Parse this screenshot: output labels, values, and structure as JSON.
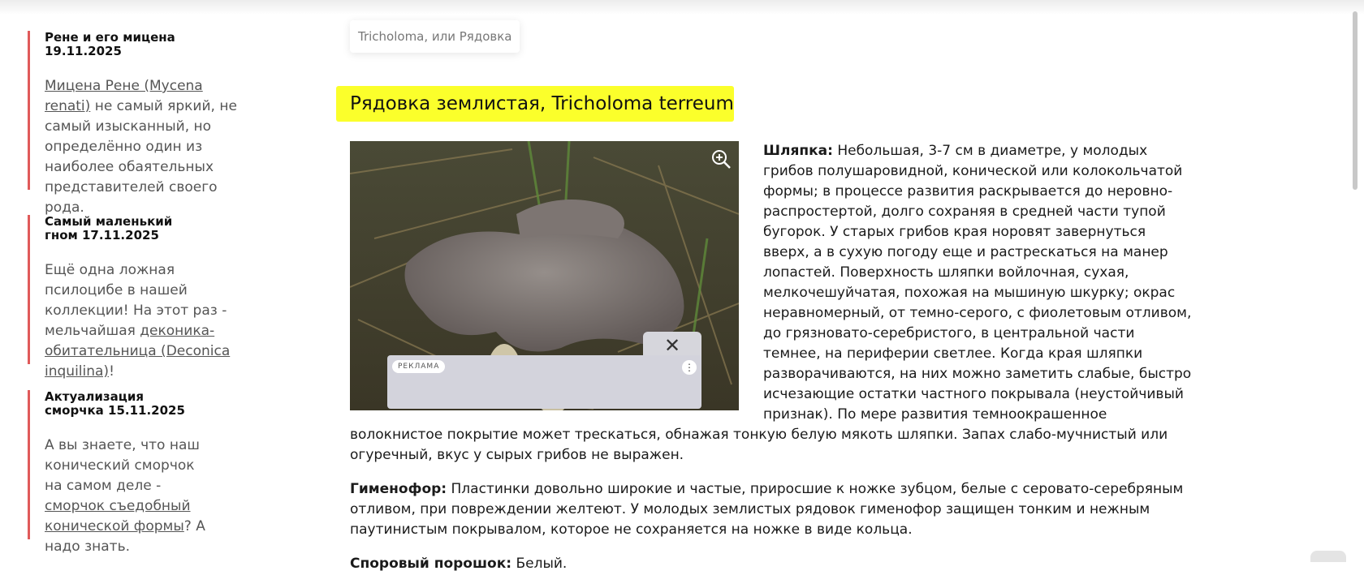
{
  "sidebar": {
    "items": [
      {
        "title": "Рене и его мицена 19.11.2025",
        "text_before": "",
        "link": "Мицена Рене (Mycena renati)",
        "text_after": " не самый яркий, не самый изысканный, но определённо один из наиболее обаятельных представителей своего рода."
      },
      {
        "title": "Самый маленький гном 17.11.2025",
        "text_before": "Ещё одна ложная псилоцибе в нашей коллекции! На этот раз - мельчайшая ",
        "link": "деконика-обитательница (Deconica inquilina)",
        "text_after": "!"
      },
      {
        "title": "Актуализация сморчка 15.11.2025",
        "text_before": "А вы знаете, что наш конический сморчок на самом деле - ",
        "link": "сморчок съедобный конической формы",
        "text_after": "? А надо знать."
      }
    ]
  },
  "breadcrumb": "Tricholoma, или Рядовка",
  "page_title": "Рядовка землистая, Tricholoma terreum",
  "ad": {
    "label": "РЕКЛАМА",
    "close_glyph": "✕",
    "menu_glyph": "⋮"
  },
  "article": {
    "cap_label": "Шляпка:",
    "cap_text": " Небольшая, 3-7 см в диаметре, у молодых грибов полушаровидной, конической или колокольчатой формы; в процессе развития раскрывается до неровно-распростертой, долго сохраняя в средней части тупой бугорок. У старых грибов края норовят завернуться вверх, а в сухую погоду еще и растрескаться на манер лопастей. Поверхность шляпки войлочная, сухая, мелкочешуйчатая, похожая на мышиную шкурку; окрас неравномерный, от темно-серого, с фиолетовым отливом, до грязновато-серебристого, в центральной части темнее, на периферии светлее. Когда края шляпки разворачиваются, на них можно заметить слабые, быстро исчезающие остатки частного покрывала (неустойчивый признак). По мере развития темноокрашенное волокнистое покрытие может трескаться, обнажая тонкую белую мякоть шляпки. Запах слабо-мучнистый или огуречный, вкус у сырых грибов не выражен.",
    "hymenophore_label": "Гименофор:",
    "hymenophore_text": " Пластинки довольно широкие и частые, приросшие к ножке зубцом, белые с серовато-серебряным отливом, при повреждении желтеют. У молодых землистых рядовок гименофор защищен тонким и нежным паутинистым покрывалом, которое не сохраняется на ножке в виде кольца.",
    "spore_label": "Споровый порошок:",
    "spore_text": " Белый."
  },
  "colors": {
    "accent_red": "#e05a5a",
    "highlight_yellow": "#fbff2b"
  }
}
